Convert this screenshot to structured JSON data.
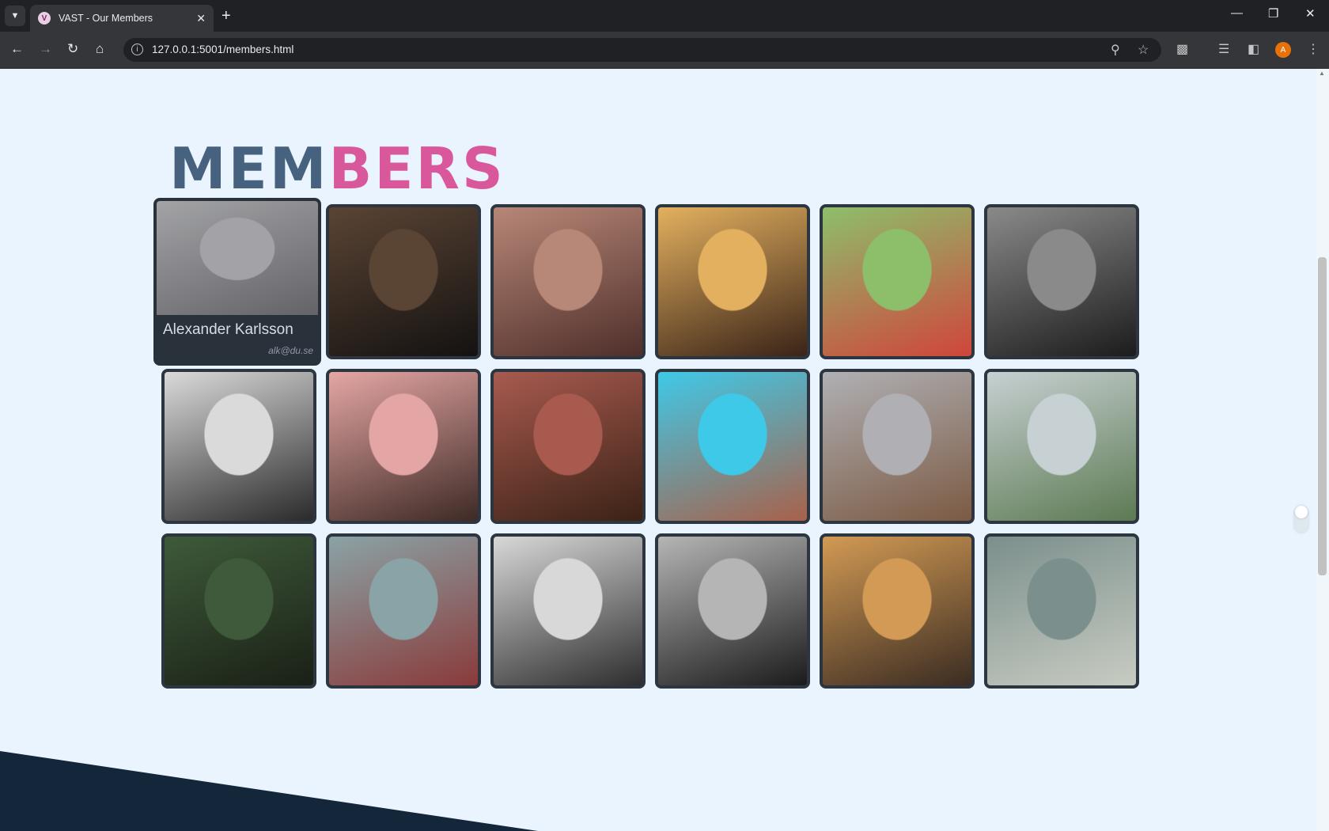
{
  "browser": {
    "tab_title": "VAST - Our Members",
    "tab_favicon_letter": "V",
    "url": "127.0.0.1:5001/members.html",
    "profile_initial": "A"
  },
  "page": {
    "title_part1": "MEM",
    "title_part2": "BERS",
    "colors": {
      "background": "#eaf4ff",
      "title_part1": "#47627f",
      "title_part2": "#d9589b",
      "card_frame": "#2c3540",
      "footer": "#14263a"
    }
  },
  "members": [
    {
      "name": "Alexander Karlsson",
      "email": "alk@du.se",
      "photo_colors": [
        "#9a9ba6",
        "#5f5e6c"
      ]
    },
    {
      "photo_colors": [
        "#5a4434",
        "#141211"
      ]
    },
    {
      "photo_colors": [
        "#b78777",
        "#4f2f2b"
      ]
    },
    {
      "photo_colors": [
        "#e3b05f",
        "#3a2418"
      ]
    },
    {
      "photo_colors": [
        "#8dbf6b",
        "#d0453b"
      ]
    },
    {
      "photo_colors": [
        "#8a8a8a",
        "#1c1c1c"
      ]
    },
    {
      "photo_colors": [
        "#dadada",
        "#2a2a2a"
      ]
    },
    {
      "photo_colors": [
        "#e4a6a4",
        "#3e2a25"
      ]
    },
    {
      "photo_colors": [
        "#a85a4f",
        "#3b2216"
      ]
    },
    {
      "photo_colors": [
        "#3fc9e8",
        "#a8614a"
      ]
    },
    {
      "photo_colors": [
        "#b0b0b4",
        "#7b5a43"
      ]
    },
    {
      "photo_colors": [
        "#c7d0d2",
        "#5c7a52"
      ]
    },
    {
      "photo_colors": [
        "#3e5a3a",
        "#1a2016"
      ]
    },
    {
      "photo_colors": [
        "#8aa3a6",
        "#8a3a3a"
      ]
    },
    {
      "photo_colors": [
        "#d8d8d8",
        "#2e2e2e"
      ]
    },
    {
      "photo_colors": [
        "#b5b5b5",
        "#1b1b1b"
      ]
    },
    {
      "photo_colors": [
        "#d29a54",
        "#3b2c22"
      ]
    },
    {
      "photo_colors": [
        "#7b8f8c",
        "#c8ccc2"
      ]
    }
  ]
}
